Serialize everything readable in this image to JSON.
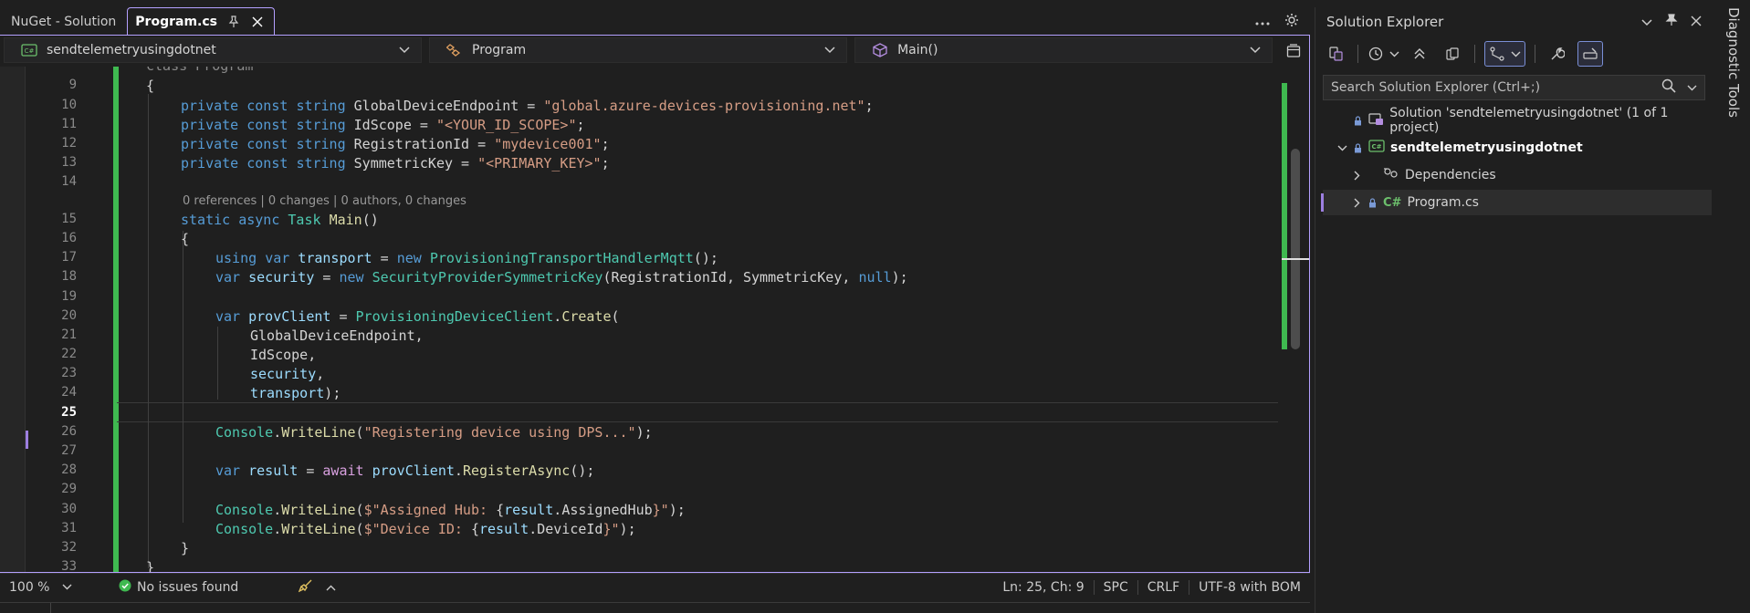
{
  "tabs": [
    {
      "label": "NuGet - Solution",
      "active": false
    },
    {
      "label": "Program.cs",
      "active": true
    }
  ],
  "nav": {
    "project": "sendtelemetryusingdotnet",
    "type": "Program",
    "member": "Main()"
  },
  "code": {
    "partial_top": "class Program",
    "current_line": 25,
    "lens": "0 references | 0 changes | 0 authors, 0 changes",
    "lines": [
      {
        "n": "9"
      },
      {
        "n": "10"
      },
      {
        "n": "11"
      },
      {
        "n": "12"
      },
      {
        "n": "13"
      },
      {
        "n": "14"
      },
      {
        "n": "15"
      },
      {
        "n": "16"
      },
      {
        "n": "17"
      },
      {
        "n": "18"
      },
      {
        "n": "19"
      },
      {
        "n": "20"
      },
      {
        "n": "21"
      },
      {
        "n": "22"
      },
      {
        "n": "23"
      },
      {
        "n": "24"
      },
      {
        "n": "25"
      },
      {
        "n": "26"
      },
      {
        "n": "27"
      },
      {
        "n": "28"
      },
      {
        "n": "29"
      },
      {
        "n": "30"
      },
      {
        "n": "31"
      },
      {
        "n": "32"
      },
      {
        "n": "33"
      }
    ],
    "tokens": {
      "brace_open": "{",
      "brace_close": "}",
      "private": "private",
      "const": "const",
      "string": "string",
      "GlobalDeviceEndpoint": "GlobalDeviceEndpoint",
      "IdScope": "IdScope",
      "RegistrationId": "RegistrationId",
      "SymmetricKey": "SymmetricKey",
      "eq": " = ",
      "s_endpoint": "\"global.azure-devices-provisioning.net\"",
      "s_scope": "\"<YOUR_ID_SCOPE>\"",
      "s_regid": "\"mydevice001\"",
      "s_key": "\"<PRIMARY_KEY>\"",
      "semi": ";",
      "static": "static",
      "async": "async",
      "Task": "Task",
      "Main": "Main",
      "parens": "()",
      "using": "using",
      "var": "var",
      "transport": "transport",
      "new": "new",
      "ProvisioningTransportHandlerMqtt": "ProvisioningTransportHandlerMqtt",
      "security": "security",
      "SecurityProviderSymmetricKey": "SecurityProviderSymmetricKey",
      "null": "null",
      "provClient": "provClient",
      "ProvisioningDeviceClient": "ProvisioningDeviceClient",
      "Create": "Create",
      "Console": "Console",
      "WriteLine": "WriteLine",
      "s_registering": "\"Registering device using DPS...\"",
      "result": "result",
      "await": "await",
      "RegisterAsync": "RegisterAsync",
      "s_hub_a": "$\"Assigned Hub: ",
      "AssignedHub": "AssignedHub",
      "s_dev_a": "$\"Device ID: ",
      "DeviceId": "DeviceId",
      "interp_close": "}\""
    }
  },
  "status": {
    "zoom": "100 %",
    "issues": "No issues found",
    "position": "Ln: 25, Ch: 9",
    "indent": "SPC",
    "line_ending": "CRLF",
    "encoding": "UTF-8 with BOM"
  },
  "solution_explorer": {
    "title": "Solution Explorer",
    "search_placeholder": "Search Solution Explorer (Ctrl+;)",
    "items": [
      {
        "label": "Solution 'sendtelemetryusingdotnet' (1 of 1 project)"
      },
      {
        "label": "sendtelemetryusingdotnet"
      },
      {
        "label": "Dependencies"
      },
      {
        "label": "Program.cs"
      }
    ]
  },
  "side_tab": "Diagnostic Tools",
  "colors": {
    "accent": "#b4a0ff",
    "change_bar": "#3fb950",
    "keyword": "#569cd6",
    "type": "#4ec9b0",
    "string": "#d69d85"
  }
}
